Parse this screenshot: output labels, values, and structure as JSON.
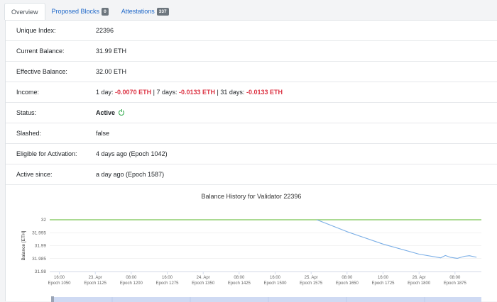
{
  "tabs": [
    {
      "label": "Overview",
      "active": true
    },
    {
      "label": "Proposed Blocks",
      "badge": "0"
    },
    {
      "label": "Attestations",
      "badge": "337"
    }
  ],
  "details": {
    "unique_index": {
      "label": "Unique Index:",
      "value": "22396"
    },
    "current_balance": {
      "label": "Current Balance:",
      "value": "31.99 ETH"
    },
    "effective_balance": {
      "label": "Effective Balance:",
      "value": "32.00 ETH"
    },
    "income": {
      "label": "Income:",
      "day1_label": "1 day:",
      "day1_value": "-0.0070 ETH",
      "day7_label": "7 days:",
      "day7_value": "-0.0133 ETH",
      "day31_label": "31 days:",
      "day31_value": "-0.0133 ETH",
      "separator": "|"
    },
    "status": {
      "label": "Status:",
      "value": "Active",
      "icon": "power-icon"
    },
    "slashed": {
      "label": "Slashed:",
      "value": "false"
    },
    "eligible": {
      "label": "Eligible for Activation:",
      "value": "4 days ago (Epoch 1042)"
    },
    "active_since": {
      "label": "Active since:",
      "value": "a day ago (Epoch 1587)"
    }
  },
  "chart_data": {
    "type": "line",
    "title": "Balance History for Validator 22396",
    "ylabel": "Balance [ETH]",
    "ylim": [
      31.98,
      32
    ],
    "yticks": [
      "32",
      "31.995",
      "31.99",
      "31.985",
      "31.98"
    ],
    "xticks": [
      {
        "top": "16:00",
        "bottom": "Epoch 1050"
      },
      {
        "top": "23. Apr",
        "bottom": "Epoch 1125"
      },
      {
        "top": "08:00",
        "bottom": "Epoch 1200"
      },
      {
        "top": "16:00",
        "bottom": "Epoch 1275"
      },
      {
        "top": "24. Apr",
        "bottom": "Epoch 1350"
      },
      {
        "top": "08:00",
        "bottom": "Epoch 1425"
      },
      {
        "top": "16:00",
        "bottom": "Epoch 1500"
      },
      {
        "top": "25. Apr",
        "bottom": "Epoch 1575"
      },
      {
        "top": "08:00",
        "bottom": "Epoch 1650"
      },
      {
        "top": "16:00",
        "bottom": "Epoch 1725"
      },
      {
        "top": "26. Apr",
        "bottom": "Epoch 1800"
      },
      {
        "top": "08:00",
        "bottom": "Epoch 1875"
      }
    ],
    "series": [
      {
        "color": "#8fce6e",
        "x": [
          1030,
          1930
        ],
        "y": [
          32,
          32
        ]
      },
      {
        "color": "#7aaee6",
        "x": [
          1587,
          1650,
          1725,
          1800,
          1845,
          1855,
          1865,
          1880,
          1895,
          1905,
          1920
        ],
        "y": [
          32.0,
          31.9954,
          31.9906,
          31.9867,
          31.9853,
          31.9862,
          31.9855,
          31.9851,
          31.9859,
          31.9861,
          31.9855
        ]
      }
    ]
  }
}
